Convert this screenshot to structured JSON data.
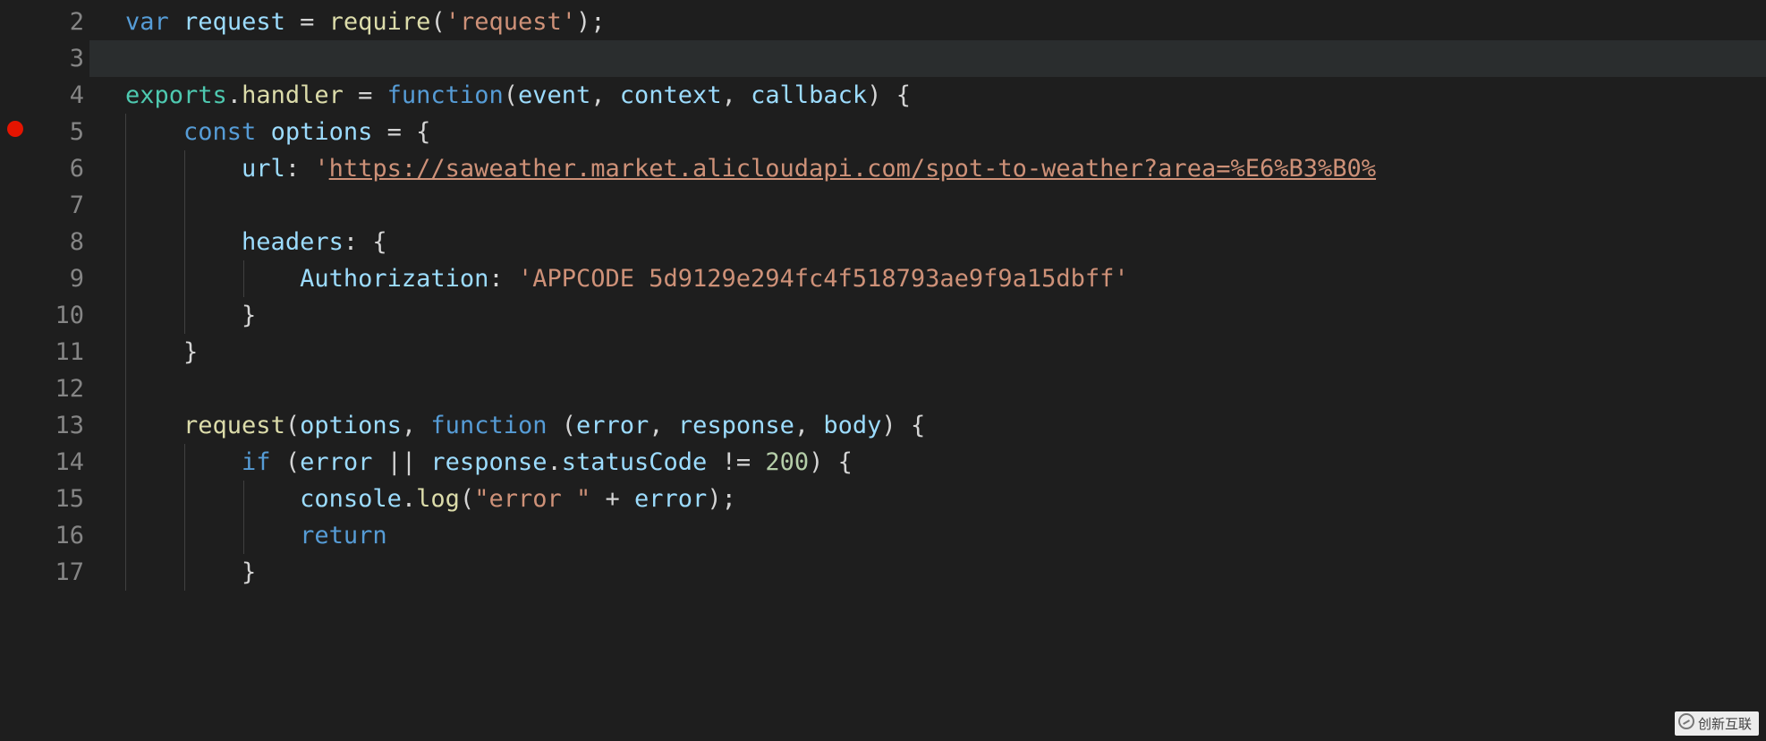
{
  "colors": {
    "background": "#1e1e1e",
    "current_line": "#2a2d2e",
    "line_number": "#858585",
    "breakpoint": "#e51400",
    "keyword": "#569CD6",
    "variable": "#9CDCFE",
    "func": "#DCDCAA",
    "string": "#CE9178",
    "number": "#B5CEA8",
    "default": "#D4D4D4",
    "module": "#4EC9B0"
  },
  "editor": {
    "first_line_number": 2,
    "breakpoint_line": 5,
    "current_line_number": 3
  },
  "gutter": {
    "ln2": "2",
    "ln3": "3",
    "ln4": "4",
    "ln5": "5",
    "ln6": "6",
    "ln7": "7",
    "ln8": "8",
    "ln9": "9",
    "ln10": "10",
    "ln11": "11",
    "ln12": "12",
    "ln13": "13",
    "ln14": "14",
    "ln15": "15",
    "ln16": "16",
    "ln17": "17"
  },
  "code": {
    "line2": {
      "t0": "var",
      "t1": " ",
      "t2": "request",
      "t3": " ",
      "t4": "=",
      "t5": " ",
      "t6": "require",
      "t7": "(",
      "t8": "'request'",
      "t9": ")",
      "t10": ";",
      "underline_dots": "..."
    },
    "line3": {
      "empty": ""
    },
    "line4": {
      "t0": "exports",
      "t1": ".",
      "t2": "handler",
      "t3": " ",
      "t4": "=",
      "t5": " ",
      "t6": "function",
      "t7": "(",
      "t8": "event",
      "t9": ",",
      "t10": " ",
      "t11": "context",
      "t12": ",",
      "t13": " ",
      "t14": "callback",
      "t15": ")",
      "t16": " ",
      "t17": "{"
    },
    "line5": {
      "indent": "    ",
      "t0": "const",
      "t1": " ",
      "t2": "options",
      "t3": " ",
      "t4": "=",
      "t5": " ",
      "t6": "{"
    },
    "line6": {
      "indent": "        ",
      "t0": "url",
      "t1": ":",
      "t2": " ",
      "t3": "'",
      "t4": "https://saweather.market.alicloudapi.com/spot-to-weather?area=%E6%B3%B0%"
    },
    "line7": {
      "indent": ""
    },
    "line8": {
      "indent": "        ",
      "t0": "headers",
      "t1": ":",
      "t2": " ",
      "t3": "{"
    },
    "line9": {
      "indent": "            ",
      "t0": "Authorization",
      "t1": ":",
      "t2": " ",
      "t3": "'APPCODE 5d9129e294fc4f518793ae9f9a15dbff'"
    },
    "line10": {
      "indent": "        ",
      "t0": "}"
    },
    "line11": {
      "indent": "    ",
      "t0": "}"
    },
    "line12": {
      "indent": ""
    },
    "line13": {
      "indent": "    ",
      "t0": "request",
      "t1": "(",
      "t2": "options",
      "t3": ",",
      "t4": " ",
      "t5": "function",
      "t6": " ",
      "t7": "(",
      "t8": "error",
      "t9": ",",
      "t10": " ",
      "t11": "response",
      "t12": ",",
      "t13": " ",
      "t14": "body",
      "t15": ")",
      "t16": " ",
      "t17": "{"
    },
    "line14": {
      "indent": "        ",
      "t0": "if",
      "t1": " ",
      "t2": "(",
      "t3": "error",
      "t4": " ",
      "t5": "||",
      "t6": " ",
      "t7": "response",
      "t8": ".",
      "t9": "statusCode",
      "t10": " ",
      "t11": "!=",
      "t12": " ",
      "t13": "200",
      "t14": ")",
      "t15": " ",
      "t16": "{"
    },
    "line15": {
      "indent": "            ",
      "t0": "console",
      "t1": ".",
      "t2": "log",
      "t3": "(",
      "t4": "\"error \"",
      "t5": " ",
      "t6": "+",
      "t7": " ",
      "t8": "error",
      "t9": ")",
      "t10": ";"
    },
    "line16": {
      "indent": "            ",
      "t0": "return"
    },
    "line17": {
      "indent": "        ",
      "t0": "}"
    }
  },
  "watermark": {
    "text": "创新互联"
  }
}
